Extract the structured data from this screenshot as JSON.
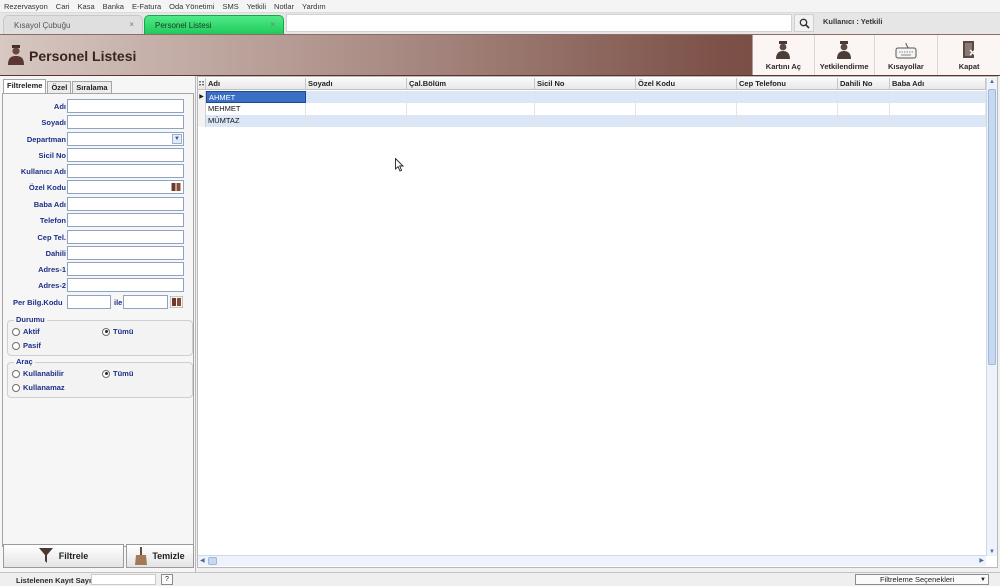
{
  "menu": [
    "Rezervasyon",
    "Cari",
    "Kasa",
    "Banka",
    "E-Fatura",
    "Oda Yönetimi",
    "SMS",
    "Yetkili",
    "Notlar",
    "Yardım"
  ],
  "tabs": [
    {
      "label": "Kısayol Çubuğu"
    },
    {
      "label": "Personel Listesi"
    }
  ],
  "close_glyph": "×",
  "user_info": "Kullanıcı : Yetkili",
  "header": {
    "title": "Personel Listesi",
    "toolbar": [
      {
        "label": "Kartını Aç",
        "icon": "person-card-icon"
      },
      {
        "label": "Yetkilendirme",
        "icon": "person-auth-icon"
      },
      {
        "label": "Kısayollar",
        "icon": "keyboard-icon"
      },
      {
        "label": "Kapat",
        "icon": "close-door-icon"
      }
    ]
  },
  "filter": {
    "tabs": [
      "Filtreleme",
      "Özel",
      "Sıralama"
    ],
    "fields": [
      "Adı",
      "Soyadı",
      "Departman",
      "Sicil No",
      "Kullanıcı Adı",
      "Özel Kodu",
      "Baba Adı",
      "Telefon",
      "Cep Tel.",
      "Dahili",
      "Adres-1",
      "Adres-2"
    ],
    "per_bilg_label": "Per Bilg.Kodu",
    "ile_label": "ile",
    "durumu": {
      "title": "Durumu",
      "opt1": "Aktif",
      "opt2": "Pasif",
      "opt3": "Tümü"
    },
    "arac": {
      "title": "Araç",
      "opt1": "Kullanabilir",
      "opt2": "Kullanamaz",
      "opt3": "Tümü"
    },
    "filter_button": "Filtrele",
    "clear_button": "Temizle"
  },
  "grid": {
    "columns": [
      "Adı",
      "Soyadı",
      "Çal.Bölüm",
      "Sicil No",
      "Özel Kodu",
      "Cep Telefonu",
      "Dahili No",
      "Baba Adı"
    ],
    "rows": [
      "AHMET",
      "MEHMET",
      "MÜMTAZ"
    ],
    "selected_row": 0
  },
  "status": {
    "listed_label": "Listelenen Kayıt Sayısı",
    "help": "?",
    "filter_options": "Filtreleme Seçenekleri"
  },
  "colors": {
    "active_tab": "#20c95c",
    "header_dark": "#6a3d35",
    "label_blue": "#1e2f86",
    "selection": "#3b6fc4"
  }
}
